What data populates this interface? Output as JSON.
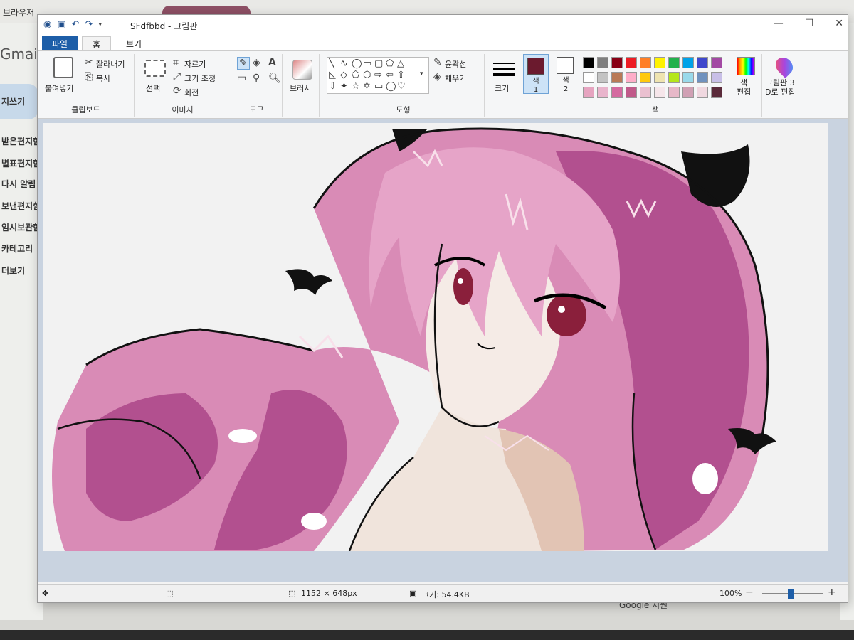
{
  "background": {
    "browser_label": "브라우저",
    "gmail_logo": "Gmail",
    "compose": "지쓰기",
    "nav_items": [
      "받은편지함",
      "별표편지함",
      "다시 알림",
      "보낸편지함",
      "임시보관함",
      "카테고리",
      "더보기"
    ],
    "footer": "Google 지원"
  },
  "window": {
    "title": "SFdfbbd - 그림판",
    "controls": [
      "—",
      "☐",
      "✕"
    ],
    "qat_icons": [
      "paint-icon",
      "save-icon",
      "undo-icon",
      "redo-icon",
      "customize-icon"
    ]
  },
  "tabs": [
    "파일",
    "홈",
    "보기"
  ],
  "ribbon": {
    "clipboard": {
      "label": "클립보드",
      "paste": "붙여넣기",
      "cut": "잘라내기",
      "copy": "복사"
    },
    "image": {
      "label": "이미지",
      "select": "선택",
      "crop": "자르기",
      "resize": "크기 조정",
      "rotate": "회전"
    },
    "tools": {
      "label": "도구"
    },
    "brushes": {
      "label": "브러시"
    },
    "shapes": {
      "label": "도형",
      "outline": "윤곽선",
      "fill": "채우기"
    },
    "size": {
      "label": "크기"
    },
    "color1": {
      "label": "색",
      "number": "1",
      "value": "#6b1a2e"
    },
    "color2": {
      "label": "색",
      "number": "2",
      "value": "#ffffff"
    },
    "colors": {
      "label": "색"
    },
    "edit_colors": {
      "label": "색\n편집"
    },
    "paint3d": {
      "label": "그림판 3\nD로 편집"
    }
  },
  "palette_row1": [
    "#000000",
    "#7f7f7f",
    "#880015",
    "#ed1c24",
    "#ff7f27",
    "#fff200",
    "#22b14c",
    "#00a2e8",
    "#3f48cc",
    "#a349a4"
  ],
  "palette_row2": [
    "#ffffff",
    "#c3c3c3",
    "#b97a57",
    "#ffaec9",
    "#ffc90e",
    "#efe4b0",
    "#b5e61d",
    "#99d9ea",
    "#7092be",
    "#c8bfe7"
  ],
  "palette_row3": [
    "#e6a4c0",
    "#e9b4cc",
    "#d46aa0",
    "#c05a8a",
    "#eac0d0",
    "#f6e6ea",
    "#e7b8c8",
    "#d0a0b4",
    "#f0d8e0",
    "#5a2a3a"
  ],
  "status": {
    "dimensions": "1152 × 648px",
    "size": "크기: 54.4KB",
    "zoom": "100%",
    "minus": "−",
    "plus": "+"
  }
}
